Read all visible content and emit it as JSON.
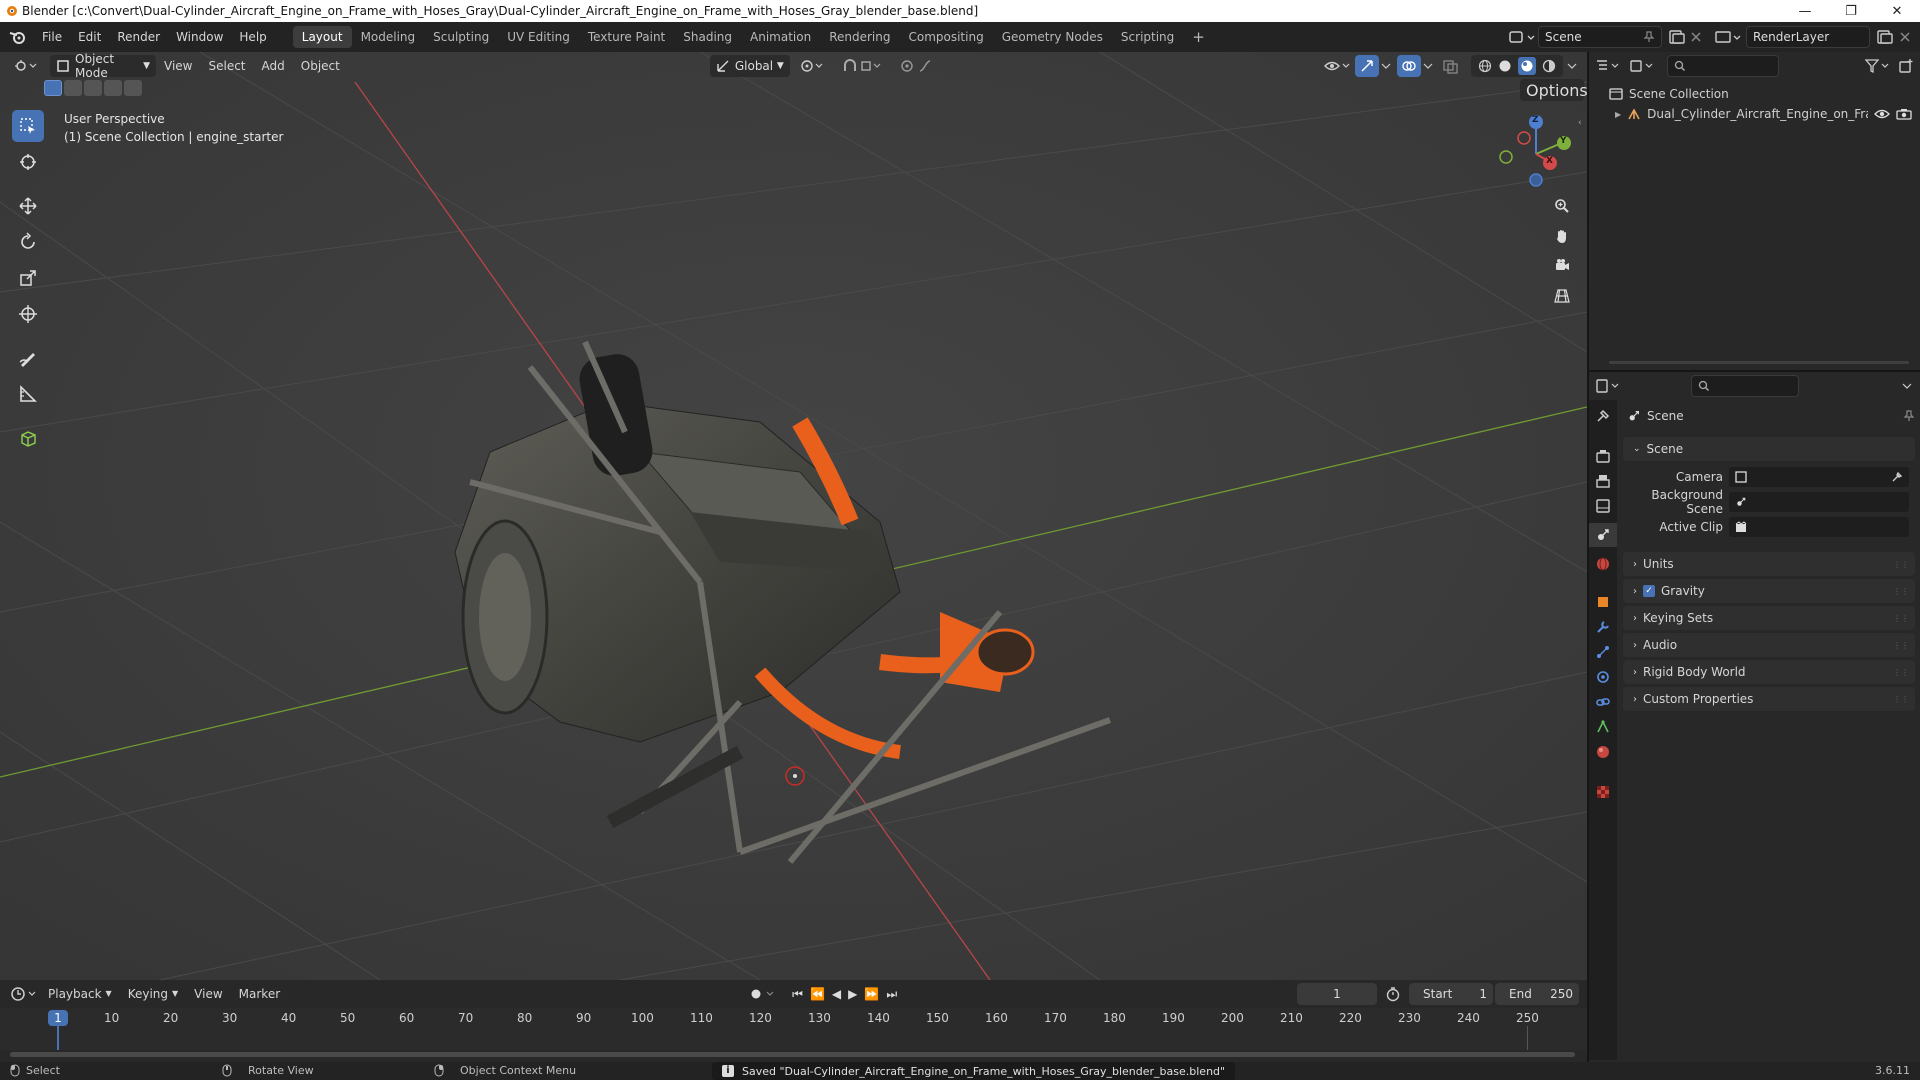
{
  "window": {
    "title": "Blender [c:\\Convert\\Dual-Cylinder_Aircraft_Engine_on_Frame_with_Hoses_Gray\\Dual-Cylinder_Aircraft_Engine_on_Frame_with_Hoses_Gray_blender_base.blend]",
    "minimize": "—",
    "maximize": "❐",
    "close": "✕"
  },
  "menu": [
    "File",
    "Edit",
    "Render",
    "Window",
    "Help"
  ],
  "workspaces": [
    "Layout",
    "Modeling",
    "Sculpting",
    "UV Editing",
    "Texture Paint",
    "Shading",
    "Animation",
    "Rendering",
    "Compositing",
    "Geometry Nodes",
    "Scripting"
  ],
  "workspace_add": "+",
  "scene_name": "Scene",
  "render_layer": "RenderLayer",
  "viewport_header": {
    "mode": "Object Mode",
    "menus": [
      "View",
      "Select",
      "Add",
      "Object"
    ],
    "orientation": "Global",
    "options": "Options"
  },
  "viewport_overlay": {
    "line1": "User Perspective",
    "line2": "(1) Scene Collection | engine_starter"
  },
  "gizmo": {
    "x": "X",
    "y": "Y",
    "z": "Z"
  },
  "outliner": {
    "root": "Scene Collection",
    "items": [
      "Dual_Cylinder_Aircraft_Engine_on_Fram"
    ]
  },
  "properties": {
    "context": "Scene",
    "section": "Scene",
    "fields": [
      {
        "label": "Camera"
      },
      {
        "label": "Background Scene"
      },
      {
        "label": "Active Clip"
      }
    ],
    "panels": [
      "Units",
      "Gravity",
      "Keying Sets",
      "Audio",
      "Rigid Body World",
      "Custom Properties"
    ],
    "gravity_checked": true
  },
  "timeline": {
    "menus": [
      "Playback",
      "Keying",
      "View",
      "Marker"
    ],
    "current_frame": "1",
    "start_label": "Start",
    "start": "1",
    "end_label": "End",
    "end": "250",
    "ticks": [
      "1",
      "10",
      "20",
      "30",
      "40",
      "50",
      "60",
      "70",
      "80",
      "90",
      "100",
      "110",
      "120",
      "130",
      "140",
      "150",
      "160",
      "170",
      "180",
      "190",
      "200",
      "210",
      "220",
      "230",
      "240",
      "250"
    ]
  },
  "statusbar": {
    "select": "Select",
    "rotate": "Rotate View",
    "context_menu": "Object Context Menu",
    "message": "Saved \"Dual-Cylinder_Aircraft_Engine_on_Frame_with_Hoses_Gray_blender_base.blend\"",
    "version": "3.6.11"
  },
  "colors": {
    "accent": "#4772b3",
    "x_axis": "#c23a3a",
    "y_axis": "#6a9a2a",
    "hose_orange": "#e8601c"
  }
}
